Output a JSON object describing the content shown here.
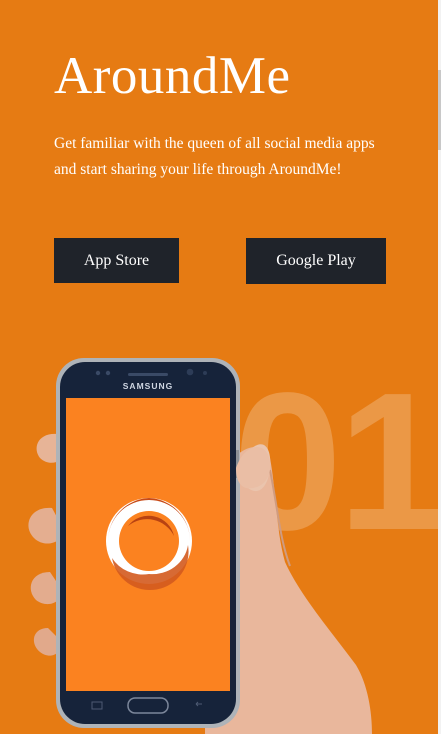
{
  "hero": {
    "title": "AroundMe",
    "tagline": "Get familiar with the queen of all social media apps and start sharing your life through AroundMe!",
    "step_number": "01"
  },
  "buttons": {
    "app_store_label": "App Store",
    "google_play_label": "Google Play"
  },
  "phone": {
    "brand_label": "SAMSUNG",
    "screen_color": "#fb8220",
    "logo_icon": "ring-logo-icon"
  },
  "colors": {
    "background": "#e67b13",
    "button": "#1f232a",
    "accent_ring": "#d0521a"
  }
}
